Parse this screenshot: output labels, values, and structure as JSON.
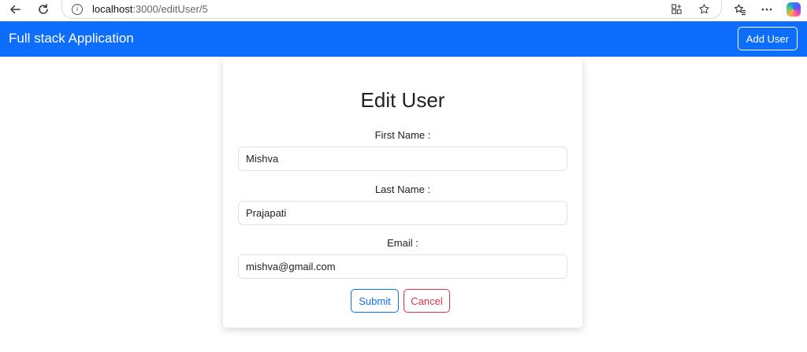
{
  "browser": {
    "url_host": "localhost",
    "url_path": ":3000/editUser/5"
  },
  "navbar": {
    "brand": "Full stack Application",
    "add_user_label": "Add User",
    "color": "#0d6efd"
  },
  "form": {
    "title": "Edit User",
    "first_name_label": "First Name :",
    "first_name_value": "Mishva",
    "last_name_label": "Last Name :",
    "last_name_value": "Prajapati",
    "email_label": "Email :",
    "email_value": "mishva@gmail.com",
    "submit_label": "Submit",
    "cancel_label": "Cancel"
  },
  "icons": [
    "back-arrow-icon",
    "reload-icon",
    "info-icon",
    "extensions-icon",
    "favorite-star-icon",
    "favorites-icon",
    "more-icon",
    "copilot-icon"
  ]
}
